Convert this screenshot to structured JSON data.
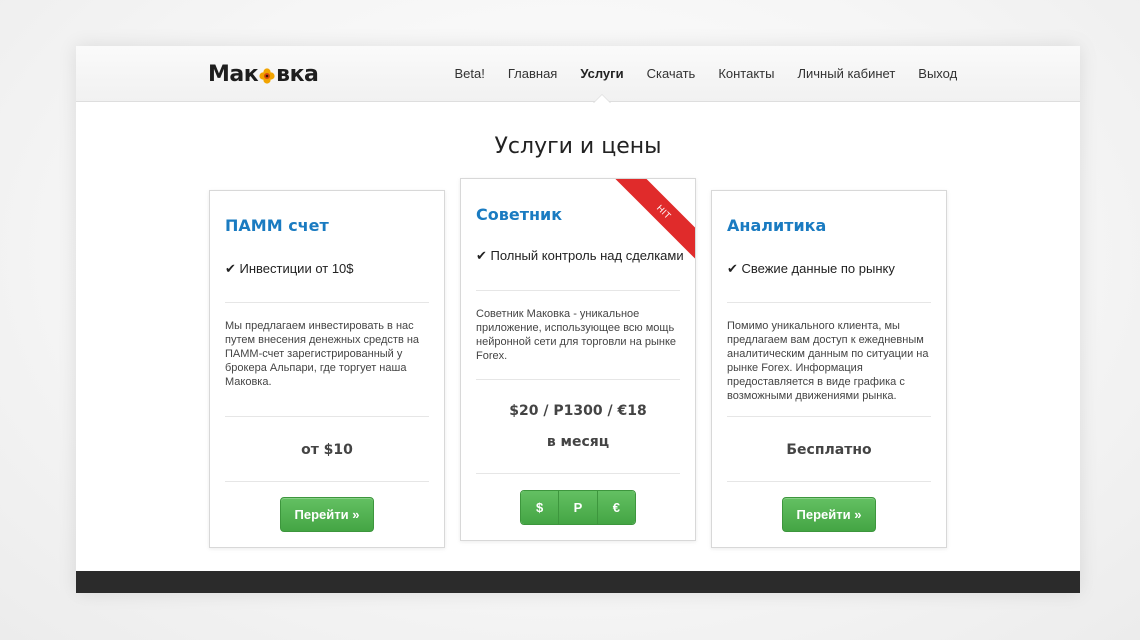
{
  "brand": {
    "part1": "Мак",
    "part2": "вка"
  },
  "nav": {
    "items": [
      {
        "label": "Beta!"
      },
      {
        "label": "Главная"
      },
      {
        "label": "Услуги"
      },
      {
        "label": "Скачать"
      },
      {
        "label": "Контакты"
      },
      {
        "label": "Личный кабинет"
      },
      {
        "label": "Выход"
      }
    ],
    "active_index": 2
  },
  "page": {
    "heading": "Услуги и цены"
  },
  "cards": [
    {
      "title": "ПАММ счет",
      "feature": "✔ Инвестиции от 10$",
      "description": "Мы предлагаем инвестировать в нас путем внесения денежных средств на ПАММ-счет зарегистрированный у брокера Альпари, где торгует наша Маковка.",
      "price": "от $10",
      "button_label": "Перейти »"
    },
    {
      "title": "Советник",
      "ribbon": "HIT",
      "feature": "✔ Полный контроль над сделками",
      "description": "Советник Маковка - уникальное приложение, использующее всю мощь нейронной сети для торговли на рынке Forex.",
      "price": "$20 / Р1300 / €18",
      "period": "в месяц",
      "buttons": [
        "$",
        "Р",
        "€"
      ]
    },
    {
      "title": "Аналитика",
      "feature": "✔ Свежие данные по рынку",
      "description": "Помимо уникального клиента, мы предлагаем вам доступ к ежедневным аналитическим данным по ситуации на рынке Forex. Информация предоставляется в виде графика с возможными движениями рынка.",
      "price": "Бесплатно",
      "button_label": "Перейти »"
    }
  ],
  "colors": {
    "accent": "#1a7bc1",
    "button": "#4caf50",
    "ribbon": "#e02b2b",
    "footer": "#2b2b2b"
  }
}
